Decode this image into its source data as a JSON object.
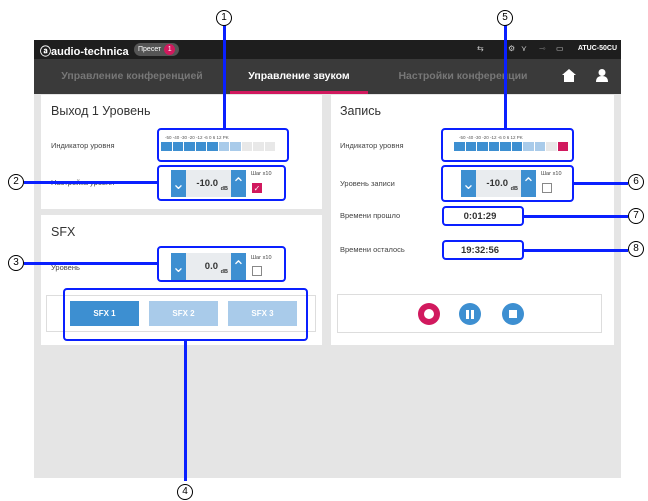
{
  "topbar": {
    "brand": "ⓐaudio-technica",
    "preset_label": "Пресет",
    "preset_number": "1",
    "model": "ATUC-50CU"
  },
  "tabs": [
    {
      "label": "Управление конференцией",
      "active": false
    },
    {
      "label": "Управление звуком",
      "active": true
    },
    {
      "label": "Настройки конференции",
      "active": false
    }
  ],
  "output_panel": {
    "title": "Выход 1 Уровень",
    "meter_label": "Индикатор уровня",
    "meter_scale": "-50 -40 -30 -20 -12 -6 0 6 12 PK",
    "meter_lit_segments": 5,
    "level_label": "Настройка уровня",
    "level_value": "-10.0",
    "unit": "dB",
    "step_label": "Шаг x10",
    "step_checked": true
  },
  "sfx_panel": {
    "title": "SFX",
    "level_label": "Уровень",
    "level_value": "0.0",
    "unit": "dB",
    "step_label": "Шаг x10",
    "step_checked": false,
    "buttons": [
      {
        "label": "SFX 1",
        "active": true
      },
      {
        "label": "SFX 2",
        "active": false
      },
      {
        "label": "SFX 3",
        "active": false
      }
    ]
  },
  "record_panel": {
    "title": "Запись",
    "meter_label": "Индикатор уровня",
    "meter_scale": "-50 -40 -30 -20 -12 -6 0 6 12 PK",
    "meter_lit_segments": 6,
    "meter_peak": true,
    "record_level_label": "Уровень записи",
    "record_level_value": "-10.0",
    "unit": "dB",
    "step_label": "Шаг x10",
    "step_checked": false,
    "elapsed_label": "Времени прошло",
    "elapsed_value": "0:01:29",
    "remaining_label": "Времени осталось",
    "remaining_value": "19:32:56"
  },
  "callouts": [
    "1",
    "2",
    "3",
    "4",
    "5",
    "6",
    "7",
    "8"
  ],
  "colors": {
    "accent_blue": "#3d8fd1",
    "light_blue": "#a9cbea",
    "brand_pink": "#d1195e",
    "callout_blue": "#0a20ff"
  }
}
